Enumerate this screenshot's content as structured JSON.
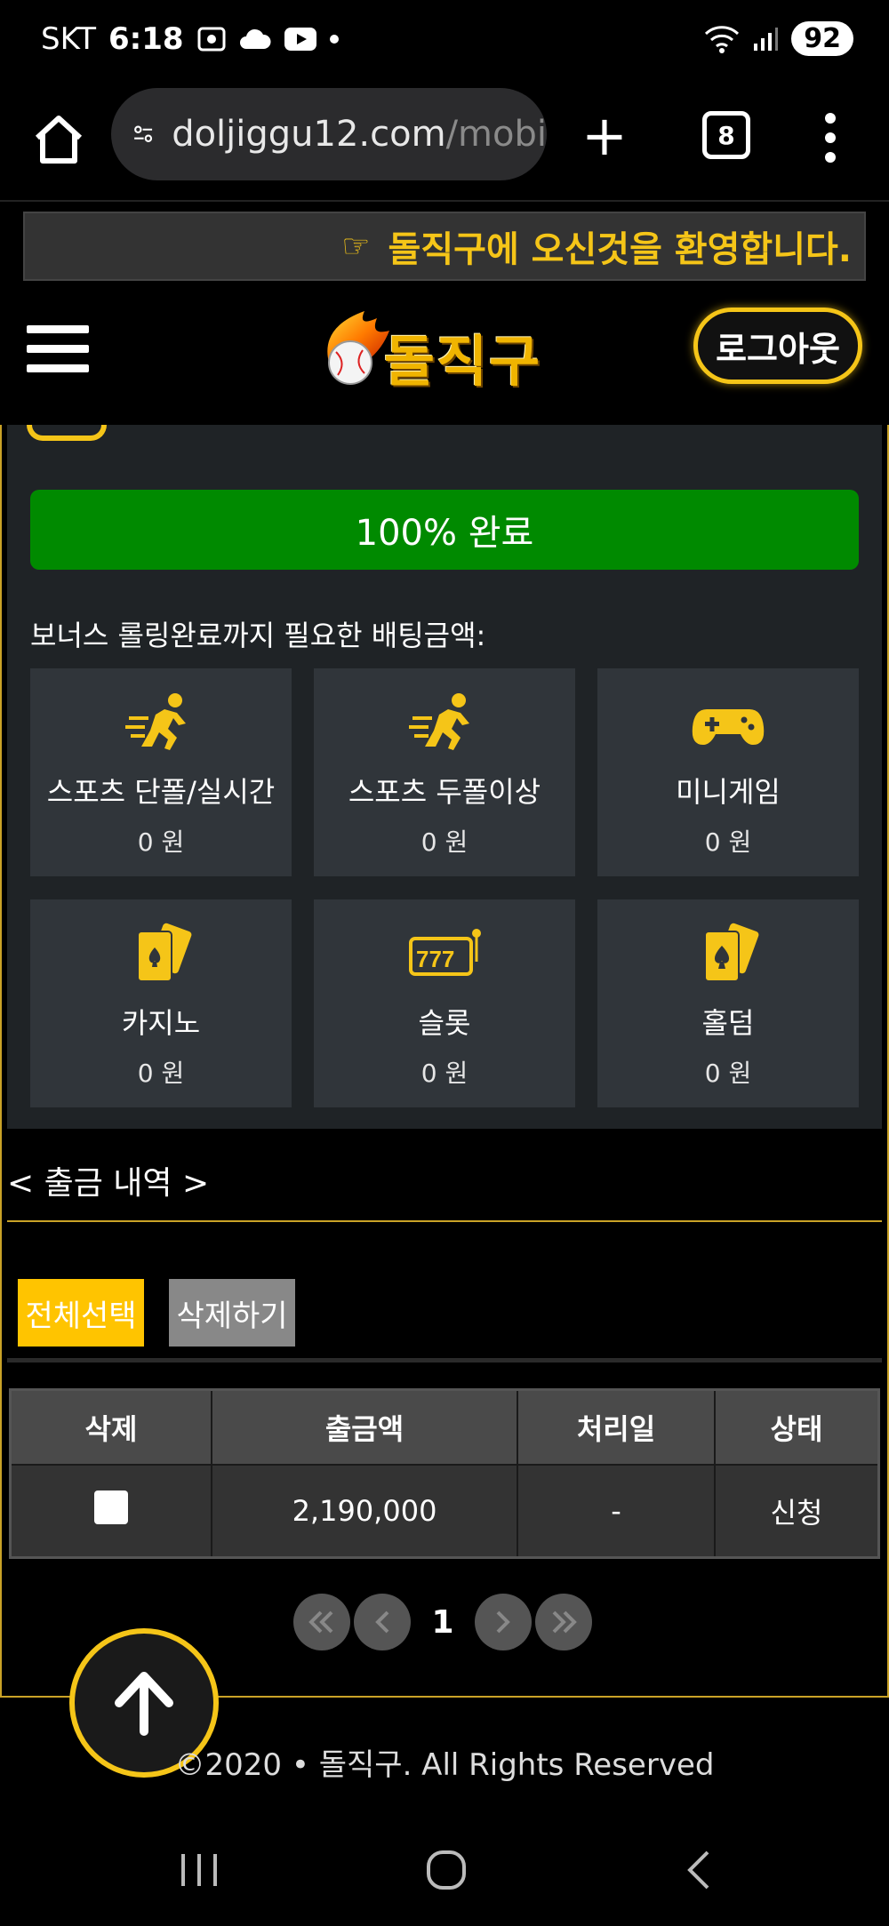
{
  "status_bar": {
    "carrier": "SKT",
    "time": "6:18",
    "battery": "92"
  },
  "browser": {
    "url_host": "doljiggu12.com",
    "url_path": "/mobi",
    "tab_count": "8"
  },
  "banner": {
    "hand": "☞",
    "text": "돌직구에 오신것을 환영합니다."
  },
  "header": {
    "logo_text": "돌직구",
    "logout_label": "로그아웃"
  },
  "bonus": {
    "progress_label": "100%  완료",
    "progress_value": 1.0,
    "label": "보너스 롤링완료까지 필요한 배팅금액:",
    "cards": [
      {
        "icon": "runner-icon",
        "name": "스포츠 단폴/실시간",
        "amount": "0 원"
      },
      {
        "icon": "runner-icon",
        "name": "스포츠 두폴이상",
        "amount": "0 원"
      },
      {
        "icon": "gamepad-icon",
        "name": "미니게임",
        "amount": "0 원"
      },
      {
        "icon": "cards-icon",
        "name": "카지노",
        "amount": "0 원"
      },
      {
        "icon": "slot-machine-icon",
        "name": "슬롯",
        "amount": "0 원"
      },
      {
        "icon": "spade-card-icon",
        "name": "홀덤",
        "amount": "0 원"
      }
    ]
  },
  "withdrawals": {
    "title": "< 출금 내역 >",
    "select_all_label": "전체선택",
    "delete_label": "삭제하기",
    "columns": [
      "삭제",
      "출금액",
      "처리일",
      "상태"
    ],
    "rows": [
      {
        "amount": "2,190,000",
        "date": "-",
        "status": "신청"
      }
    ],
    "page": "1"
  },
  "footer": {
    "text": "©2020 • 돌직구. All Rights Reserved"
  },
  "colors": {
    "accent": "#f5c518",
    "progress": "#008a00",
    "panel": "#1f2326",
    "card": "#30353a"
  }
}
